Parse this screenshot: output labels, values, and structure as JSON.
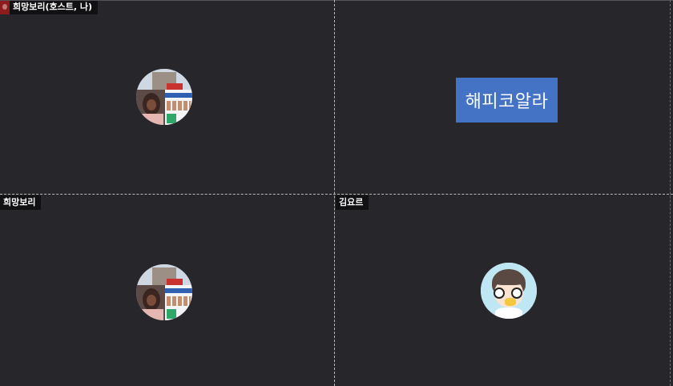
{
  "participants": [
    {
      "name": "희망보리(호스트, 나)",
      "is_host": true,
      "display": "profile-photo"
    },
    {
      "name": "해피코알라",
      "display": "name-card"
    },
    {
      "name": "희망보리",
      "display": "profile-photo"
    },
    {
      "name": "김요르",
      "display": "profile-photo"
    }
  ],
  "colors": {
    "background": "#27262b",
    "name_card": "#4472c4",
    "name_tag_bg": "#111114",
    "host_badge": "#8c1b1b"
  }
}
